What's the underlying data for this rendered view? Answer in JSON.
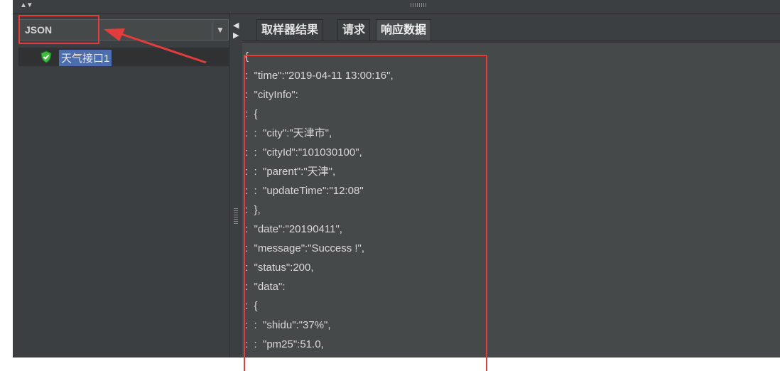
{
  "renderer": {
    "selected": "JSON"
  },
  "tree": {
    "items": [
      {
        "label": "天气接口1",
        "status": "success"
      }
    ]
  },
  "tabs": [
    {
      "label": "取样器结果"
    },
    {
      "label": "请求"
    },
    {
      "label": "响应数据",
      "active": true
    }
  ],
  "response": {
    "lines": [
      "{",
      ":  \"time\":\"2019-04-11 13:00:16\",",
      ":  \"cityInfo\":",
      ":  {",
      ":  :  \"city\":\"天津市\",",
      ":  :  \"cityId\":\"101030100\",",
      ":  :  \"parent\":\"天津\",",
      ":  :  \"updateTime\":\"12:08\"",
      ":  },",
      ":  \"date\":\"20190411\",",
      ":  \"message\":\"Success !\",",
      ":  \"status\":200,",
      ":  \"data\":",
      ":  {",
      ":  :  \"shidu\":\"37%\",",
      ":  :  \"pm25\":51.0,"
    ]
  },
  "colors": {
    "annotation": "#e23c3c",
    "selection": "#4b6eaf",
    "success_icon": "#3dbb3d"
  }
}
